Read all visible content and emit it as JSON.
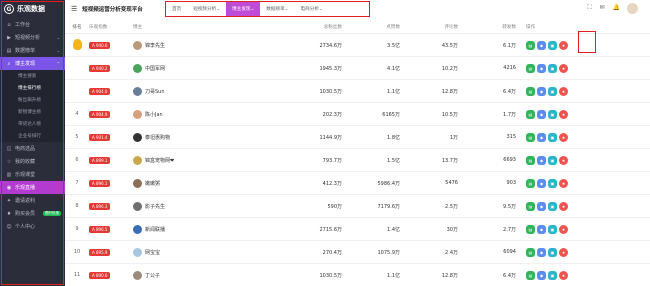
{
  "sidebar": {
    "logo": "乐观数据",
    "items": [
      {
        "label": "工作台",
        "icon": "home-icon"
      },
      {
        "label": "短视频分析",
        "icon": "video-icon"
      },
      {
        "label": "数据榜单",
        "icon": "chart-icon"
      },
      {
        "label": "博主发现",
        "icon": "search-icon",
        "active": true
      }
    ],
    "subitems": [
      "博主搜索",
      "博主排行榜",
      "粉丝飙升榜",
      "新锐博主榜",
      "带货达人榜",
      "企业号排行"
    ],
    "bottom_items": [
      {
        "label": "电商选品",
        "icon": "cart-icon"
      },
      {
        "label": "我的收藏",
        "icon": "star-icon"
      },
      {
        "label": "乐观课堂",
        "icon": "book-icon"
      },
      {
        "label": "乐观直播",
        "icon": "live-icon",
        "promo": true
      },
      {
        "label": "邀请返利",
        "icon": "gift-icon"
      },
      {
        "label": "购买会员",
        "icon": "vip-icon",
        "tag": "限时优惠"
      },
      {
        "label": "个人中心",
        "icon": "user-icon"
      }
    ]
  },
  "header": {
    "title": "短视频运营分析变现平台",
    "tabs": [
      "首页",
      "短视频分析",
      "博主发现",
      "数据榜单",
      "电商分析"
    ],
    "active_tab": 2
  },
  "table": {
    "columns": [
      "排名",
      "乐观指数",
      "博主",
      "总粉丝数",
      "点赞数",
      "评论数",
      "转发数",
      "操作"
    ],
    "rows": [
      {
        "rank": "",
        "index": "A 940.6",
        "name": "锦李先生",
        "fans": "2734.6万",
        "likes": "3.5亿",
        "comments": "43.5万",
        "shares": "6.1万"
      },
      {
        "rank": "",
        "index": "A 940.2",
        "name": "中国军网",
        "fans": "1945.3万",
        "likes": "4.1亿",
        "comments": "10.2万",
        "shares": "4216"
      },
      {
        "rank": "",
        "index": "A 904.0",
        "name": "刀哥Sun",
        "fans": "1030.5万",
        "likes": "1.1亿",
        "comments": "12.8万",
        "shares": "6.4万"
      },
      {
        "rank": "4",
        "index": "A 904.9",
        "name": "陈小Jan",
        "fans": "202.3万",
        "likes": "6165万",
        "comments": "10.5万",
        "shares": "1.7万"
      },
      {
        "rank": "5",
        "index": "A 901.4",
        "name": "泰坦惠购物",
        "fans": "1144.9万",
        "likes": "1.8亿",
        "comments": "1万",
        "shares": "315"
      },
      {
        "rank": "6",
        "index": "A 899.1",
        "name": "锦盒宠物网❤",
        "fans": "793.7万",
        "likes": "1.5亿",
        "comments": "13.7万",
        "shares": "6693"
      },
      {
        "rank": "7",
        "index": "A 896.1",
        "name": "嫩嫩粥",
        "fans": "412.3万",
        "likes": "5986.4万",
        "comments": "5476",
        "shares": "903"
      },
      {
        "rank": "8",
        "index": "A 896.3",
        "name": "影子先生",
        "fans": "590万",
        "likes": "7179.6万",
        "comments": "2.5万",
        "shares": "9.5万"
      },
      {
        "rank": "9",
        "index": "A 896.5",
        "name": "新闻联播",
        "fans": "2715.6万",
        "likes": "1.4亿",
        "comments": "30万",
        "shares": "2.7万"
      },
      {
        "rank": "10",
        "index": "A 895.9",
        "name": "网宝宝",
        "fans": "270.4万",
        "likes": "1075.9万",
        "comments": "2.4万",
        "shares": "6094"
      },
      {
        "rank": "11",
        "index": "A 890.6",
        "name": "丁公子",
        "fans": "1030.5万",
        "likes": "1.1亿",
        "comments": "12.8万",
        "shares": "6.4万"
      }
    ]
  },
  "colors": {
    "accent": "#7b55e8",
    "badge": "#e53935",
    "highlight_box": "#e02020"
  }
}
